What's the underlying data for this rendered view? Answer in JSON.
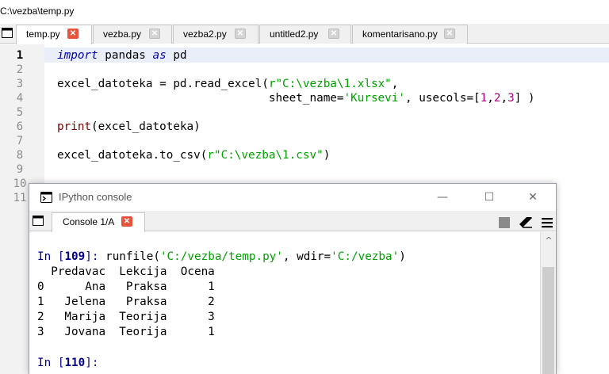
{
  "path": "C:\\vezba\\temp.py",
  "tabs": [
    {
      "label": "temp.py",
      "active": true
    },
    {
      "label": "vezba.py",
      "active": false
    },
    {
      "label": "vezba2.py",
      "active": false
    },
    {
      "label": "untitled2.py",
      "active": false
    },
    {
      "label": "komentarisano.py",
      "active": false
    }
  ],
  "editor": {
    "line_numbers": [
      "1",
      "2",
      "3",
      "4",
      "5",
      "6",
      "7",
      "8",
      "9",
      "10",
      "11"
    ],
    "current_line": 1,
    "code": {
      "l1_kw1": "import",
      "l1_mid": " pandas ",
      "l1_kw2": "as",
      "l1_end": " pd",
      "l3_pre": "excel_datoteka = pd.read_excel(",
      "l3_str": "r\"C:\\vezba\\1.xlsx\"",
      "l3_end": ",",
      "l4_pre": "                               sheet_name=",
      "l4_str": "'Kursevi'",
      "l4_mid": ", usecols=[",
      "l4_n1": "1",
      "l4_c1": ",",
      "l4_n2": "2",
      "l4_c2": ",",
      "l4_n3": "3",
      "l4_end": "] )",
      "l6_fn": "print",
      "l6_end": "(excel_datoteka)",
      "l8_pre": "excel_datoteka.to_csv(",
      "l8_str": "r\"C:\\vezba\\1.csv\"",
      "l8_end": ")"
    }
  },
  "console": {
    "title": "IPython console",
    "tab_label": "Console 1/A",
    "window_buttons": {
      "minimize": "—",
      "maximize": "☐",
      "close": "✕"
    },
    "in1_label": "In [",
    "in1_num": "109",
    "in1_close": "]:",
    "in1_pre": " runfile(",
    "in1_str1": "'C:/vezba/temp.py'",
    "in1_mid": ", wdir=",
    "in1_str2": "'C:/vezba'",
    "in1_end": ")",
    "table_header": "  Predavac  Lekcija  Ocena",
    "table_rows": [
      "0      Ana   Praksa      1",
      "1   Jelena   Praksa      2",
      "2   Marija  Teorija      3",
      "3   Jovana  Teorija      1"
    ],
    "in2_label": "In [",
    "in2_num": "110",
    "in2_close": "]:"
  },
  "icons": {
    "tab_close": "close-icon",
    "console": "terminal-icon",
    "stop": "stop-icon",
    "clear": "eraser-icon",
    "menu": "hamburger-icon"
  },
  "colors": {
    "keyword": "#0000b0",
    "string": "#00a000",
    "number": "#b00080",
    "builtin": "#7f0000",
    "prompt": "#00008b",
    "tab_close_active": "#e8533c"
  }
}
